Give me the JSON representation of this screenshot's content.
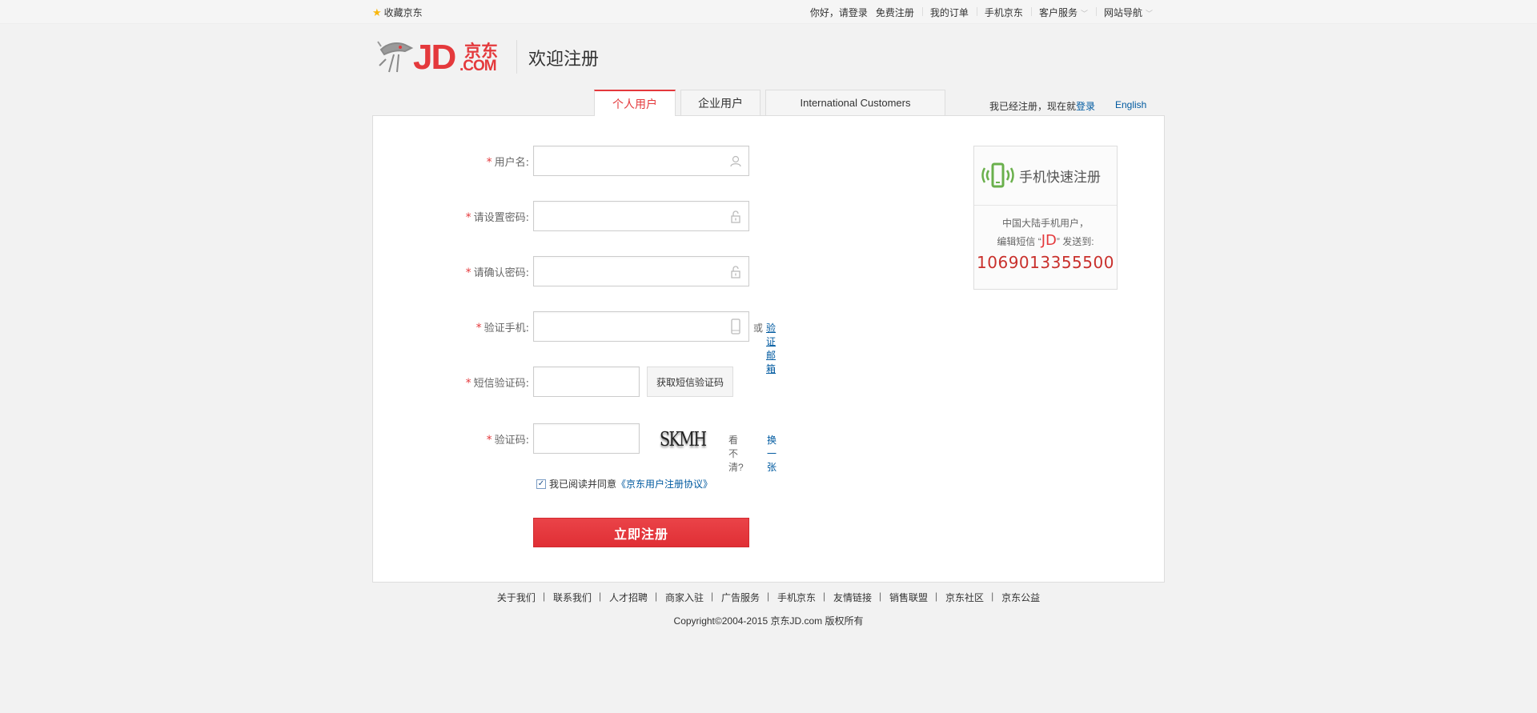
{
  "topbar": {
    "favorite_label": "收藏京东",
    "greeting": "你好，请登录",
    "nav": [
      {
        "label": "免费注册",
        "arrow": false
      },
      {
        "label": "我的订单",
        "arrow": false
      },
      {
        "label": "手机京东",
        "arrow": false
      },
      {
        "label": "客户服务",
        "arrow": true
      },
      {
        "label": "网站导航",
        "arrow": true
      }
    ]
  },
  "header": {
    "logo_jd": "JD",
    "logo_jingdong": "京东",
    "logo_com": ".COM",
    "title": "欢迎注册"
  },
  "tabs": [
    {
      "label": "个人用户",
      "active": true
    },
    {
      "label": "企业用户",
      "active": false
    },
    {
      "label": "International Customers",
      "active": false
    }
  ],
  "login_hint": {
    "text": "我已经注册，现在就",
    "link": "登录",
    "english": "English"
  },
  "form": {
    "username_label": "用户名:",
    "password_label": "请设置密码:",
    "confirm_label": "请确认密码:",
    "phone_label": "验证手机:",
    "or_text": "或",
    "verify_email_link": "验证邮箱",
    "sms_label": "短信验证码:",
    "sms_button": "获取短信验证码",
    "captcha_label": "验证码:",
    "captcha_text": "SKMH",
    "cant_see": "看不清?",
    "refresh_link": "换一张",
    "agree_text": "我已阅读并同意",
    "agreement_link": "《京东用户注册协议》",
    "submit": "立即注册"
  },
  "mobile_register": {
    "title": "手机快速注册",
    "line1": "中国大陆手机用户，",
    "line2_prefix": "编辑短信 “",
    "keyword": "JD",
    "line2_suffix": "” 发送到:",
    "number": "1069013355500"
  },
  "footer": {
    "links": [
      "关于我们",
      "联系我们",
      "人才招聘",
      "商家入驻",
      "广告服务",
      "手机京东",
      "友情链接",
      "销售联盟",
      "京东社区",
      "京东公益"
    ],
    "copyright": "Copyright©2004-2015  京东JD.com 版权所有"
  },
  "colors": {
    "accent": "#e4393c",
    "link": "#005aa0",
    "mobile_green": "#6ab04c"
  }
}
